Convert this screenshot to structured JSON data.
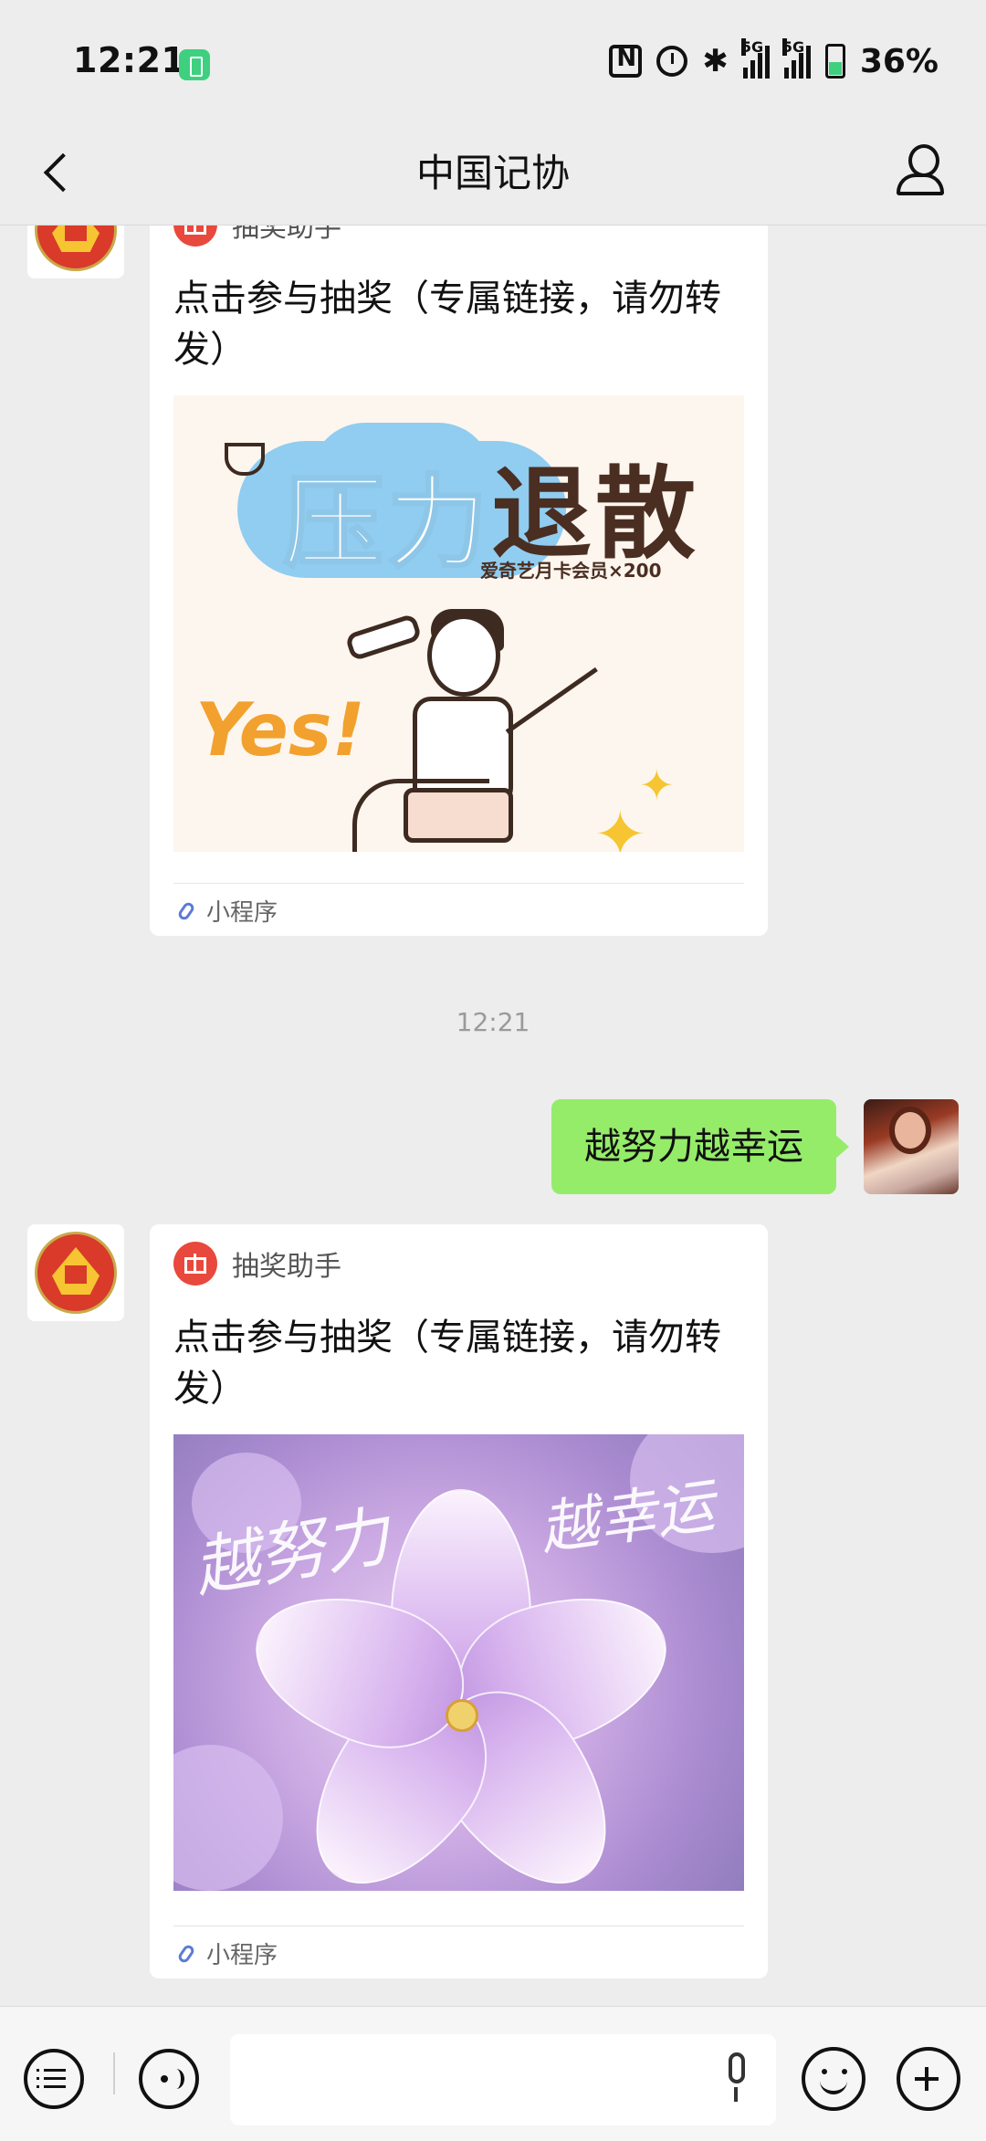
{
  "status_bar": {
    "time": "12:21",
    "network_1": "5G",
    "network_2": "5G",
    "battery": "36%"
  },
  "nav": {
    "title": "中国记协"
  },
  "messages": [
    {
      "type": "mini_program_card",
      "source": "抽奖助手",
      "title": "点击参与抽奖（专属链接，请勿转发）",
      "image": {
        "headline_1": "压力",
        "headline_2": "退散",
        "tagline": "爱奇艺月卡会员×200",
        "accent_text": "Yes!"
      },
      "footer": "小程序"
    },
    {
      "type": "timestamp",
      "text": "12:21"
    },
    {
      "type": "outgoing_text",
      "text": "越努力越幸运"
    },
    {
      "type": "mini_program_card",
      "source": "抽奖助手",
      "title": "点击参与抽奖（专属链接，请勿转发）",
      "image": {
        "script_left": "越努力",
        "script_right": "越幸运"
      },
      "footer": "小程序"
    }
  ],
  "input_bar": {
    "placeholder": ""
  },
  "icons": [
    "back-icon",
    "user-profile-icon",
    "gift-icon",
    "mini-program-link-icon",
    "menu-list-icon",
    "voice-icon",
    "microphone-icon",
    "emoji-icon",
    "plus-icon"
  ],
  "colors": {
    "background": "#ededed",
    "outgoing_bubble": "#95ec69",
    "gift_accent": "#e9483c",
    "link_icon": "#5b7bd5"
  }
}
